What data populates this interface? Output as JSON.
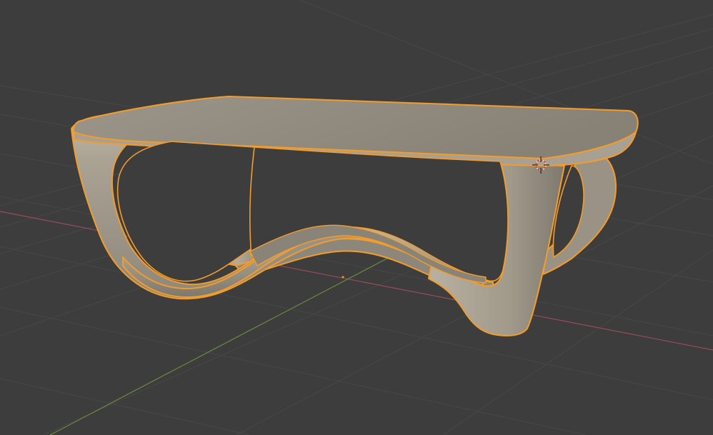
{
  "viewport": {
    "background_color": "#3d3d3d",
    "grid_color": "#474747",
    "x_axis_color": "#9a4a5a",
    "y_axis_color": "#6a8a3e",
    "selection_outline_color": "#f39c2a",
    "object_base_color": "#a59d8d",
    "object_top_color": "#958e82",
    "object_shadow_color": "#6f6a61",
    "object_highlight_color": "#c6beaf",
    "icons": [
      "3d-cursor-icon",
      "object-origin-icon"
    ]
  }
}
